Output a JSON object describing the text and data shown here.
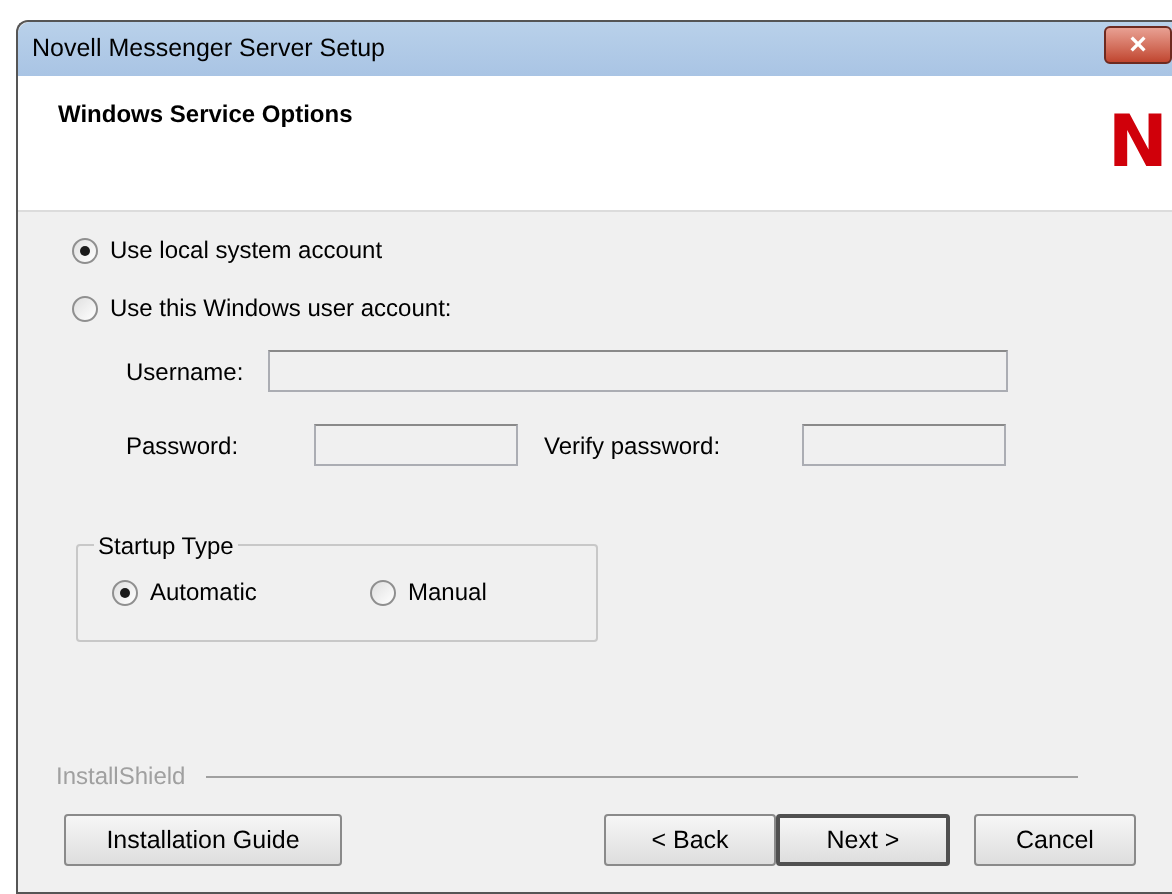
{
  "window": {
    "title": "Novell Messenger Server Setup",
    "close": "×"
  },
  "header": {
    "title": "Windows Service Options",
    "logo": "N"
  },
  "account_options": [
    {
      "label": "Use local system account",
      "selected": true
    },
    {
      "label": "Use this Windows user account:",
      "selected": false
    }
  ],
  "username": {
    "label": "Username:",
    "disabled": true
  },
  "password": {
    "label": "Password:",
    "disabled": true
  },
  "verify_password": {
    "label": "Verify password:",
    "disabled": true
  },
  "startup_type": {
    "legend": "Startup Type",
    "options": [
      {
        "label": "Automatic",
        "selected": true
      },
      {
        "label": "Manual",
        "selected": false
      }
    ]
  },
  "footer": {
    "brand": "InstallShield"
  },
  "buttons": [
    {
      "label": "Installation Guide",
      "default": false
    },
    {
      "label": "< Back",
      "default": false
    },
    {
      "label": "Next >",
      "default": true
    },
    {
      "label": "Cancel",
      "default": false
    }
  ]
}
